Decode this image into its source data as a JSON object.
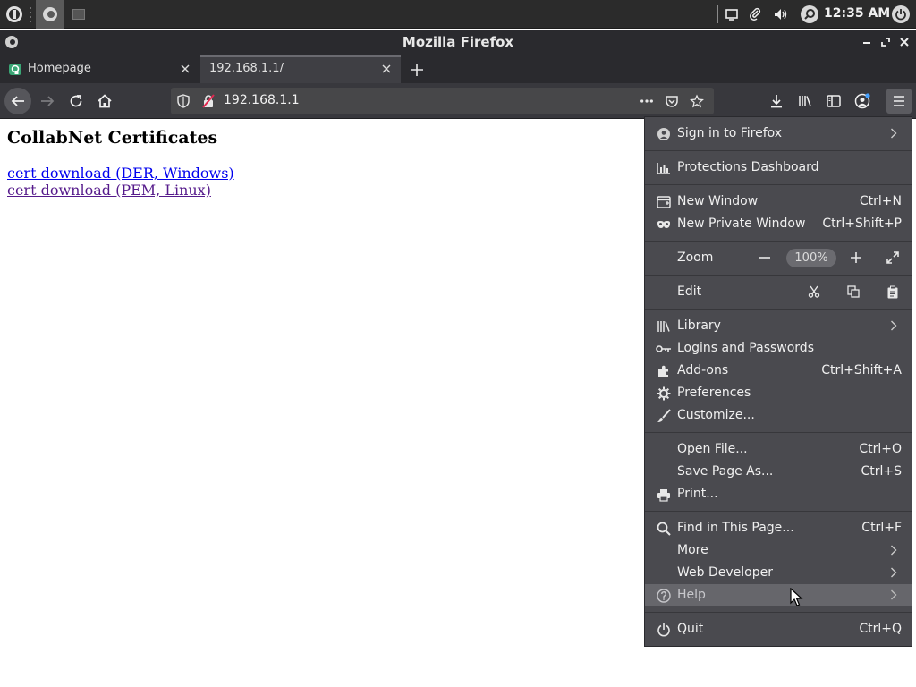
{
  "taskbar": {
    "clock": "12:35 AM"
  },
  "window": {
    "title": "Mozilla Firefox"
  },
  "tabs": [
    {
      "label": "Homepage"
    },
    {
      "label": "192.168.1.1/"
    }
  ],
  "urlbar": {
    "value": "192.168.1.1"
  },
  "page": {
    "title": "CollabNet Certificates",
    "links": [
      {
        "label": "cert download (DER, Windows)"
      },
      {
        "label": "cert download (PEM, Linux)"
      }
    ]
  },
  "menu": {
    "sign_in": "Sign in to Firefox",
    "protections": "Protections Dashboard",
    "new_window": "New Window",
    "new_window_key": "Ctrl+N",
    "new_private": "New Private Window",
    "new_private_key": "Ctrl+Shift+P",
    "zoom": "Zoom",
    "zoom_value": "100%",
    "edit": "Edit",
    "library": "Library",
    "logins": "Logins and Passwords",
    "addons": "Add-ons",
    "addons_key": "Ctrl+Shift+A",
    "preferences": "Preferences",
    "customize": "Customize...",
    "open_file": "Open File...",
    "open_file_key": "Ctrl+O",
    "save_page": "Save Page As...",
    "save_page_key": "Ctrl+S",
    "print": "Print...",
    "find": "Find in This Page...",
    "find_key": "Ctrl+F",
    "more": "More",
    "web_dev": "Web Developer",
    "help": "Help",
    "quit": "Quit",
    "quit_key": "Ctrl+Q"
  }
}
